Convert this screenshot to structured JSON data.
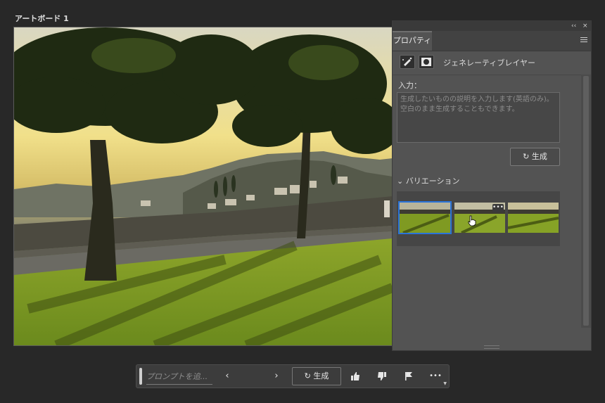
{
  "artboard": {
    "title": "アートボード 1"
  },
  "panel": {
    "collapse_glyph": "‹‹",
    "close_glyph": "×",
    "tab_label": "プロパティ",
    "layer_name": "ジェネレーティブレイヤー",
    "input_label": "入力：",
    "prompt_placeholder": "生成したいものの説明を入力します(英語のみ)。空白のまま生成することもできます。",
    "generate_label": "生成",
    "variations_label": "バリエーション",
    "more_glyph": "•••"
  },
  "taskbar": {
    "prompt_placeholder": "プロンプトを追...",
    "prev_glyph": "‹",
    "next_glyph": "›",
    "generate_label": "生成",
    "more_glyph": "•••"
  },
  "colors": {
    "background": "#282828",
    "panel": "#535353",
    "selected_outline": "#2a74da"
  }
}
